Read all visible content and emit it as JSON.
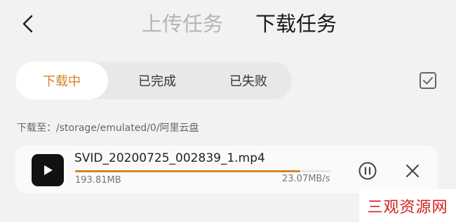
{
  "header": {
    "back_icon": "chevron-left-icon",
    "tab_upload": "上传任务",
    "tab_download": "下载任务",
    "active_tab": "下载任务"
  },
  "filter": {
    "items": [
      {
        "label": "下载中",
        "active": true
      },
      {
        "label": "已完成",
        "active": false
      },
      {
        "label": "已失败",
        "active": false
      }
    ],
    "select_icon": "checkbox-icon"
  },
  "path": {
    "text": "下载至：/storage/emulated/0/阿里云盘"
  },
  "tasks": [
    {
      "file_name": "SVID_20200725_002839_1.mp4",
      "file_icon": "video-play-icon",
      "size": "193.81MB",
      "speed": "23.07MB/s",
      "progress": 0.88,
      "pause_icon": "pause-circle-icon",
      "cancel_icon": "close-icon"
    }
  ],
  "watermark": {
    "text": "三观资源网"
  },
  "colors": {
    "accent": "#d4832a",
    "background": "#f2f2f2",
    "watermark": "#d42020"
  }
}
